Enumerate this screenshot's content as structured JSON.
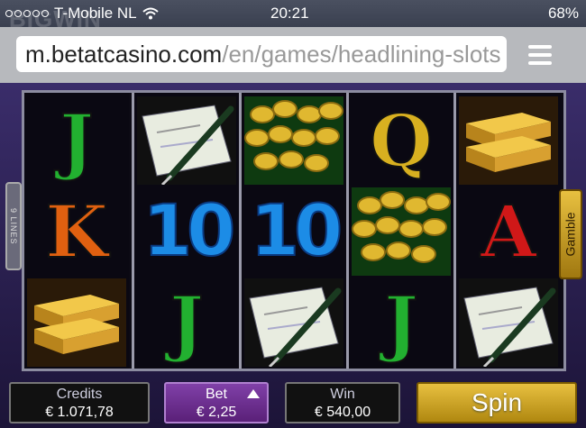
{
  "statusbar": {
    "carrier": "T-Mobile NL",
    "time": "20:21",
    "battery": "68%"
  },
  "watermark": "BIGWIN",
  "browser": {
    "url_host": "m.betatcasino.com",
    "url_path": "/en/games/headlining-slots"
  },
  "game": {
    "lines_label": "9 LINES",
    "gamble_label": "Gamble",
    "reels": [
      [
        "J",
        "K",
        "gold-bars"
      ],
      [
        "cheque",
        "10",
        "J"
      ],
      [
        "coins",
        "10",
        "cheque"
      ],
      [
        "Q",
        "coins",
        "J"
      ],
      [
        "gold-bars",
        "A",
        "cheque"
      ]
    ],
    "credits_label": "Credits",
    "credits_value": "€ 1.071,78",
    "bet_label": "Bet",
    "bet_value": "€ 2,25",
    "win_label": "Win",
    "win_value": "€ 540,00",
    "spin_label": "Spin"
  },
  "colors": {
    "gold": "#e8c040",
    "bet_purple": "#8040a8",
    "ten_blue": "#1c8ce6"
  }
}
